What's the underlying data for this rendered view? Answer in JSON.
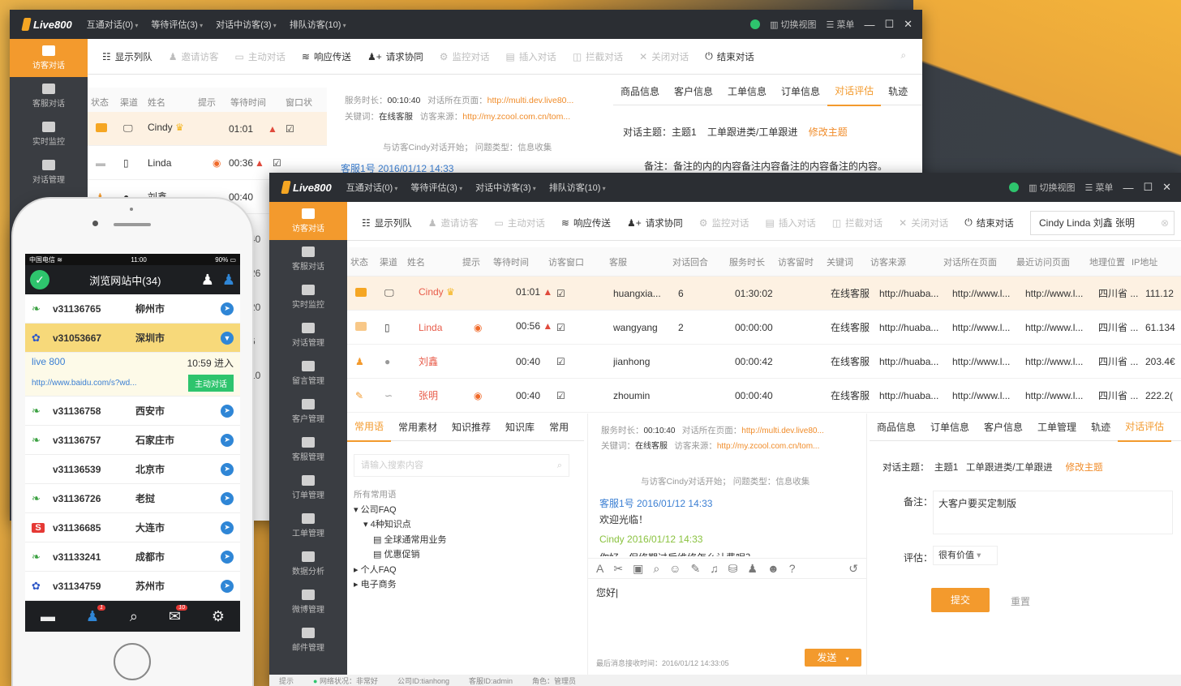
{
  "back_window": {
    "logo": "Live800",
    "menus": [
      "互通对话(0)",
      "等待评估(3)",
      "对话中访客(3)",
      "排队访客(10)"
    ],
    "right": {
      "switch": "切换视图",
      "menu": "菜单"
    },
    "sidebar": [
      {
        "label": "访客对话"
      },
      {
        "label": "客服对话"
      },
      {
        "label": "实时监控"
      },
      {
        "label": "对话管理"
      }
    ],
    "toolbar": [
      {
        "label": "显示列队",
        "enabled": true
      },
      {
        "label": "邀请访客",
        "enabled": false
      },
      {
        "label": "主动对话",
        "enabled": false
      },
      {
        "label": "响应传送",
        "enabled": true
      },
      {
        "label": "请求协同",
        "enabled": true
      },
      {
        "label": "监控对话",
        "enabled": false
      },
      {
        "label": "插入对话",
        "enabled": false
      },
      {
        "label": "拦截对话",
        "enabled": false
      },
      {
        "label": "关闭对话",
        "enabled": false
      },
      {
        "label": "结束对话",
        "enabled": true
      }
    ],
    "columns": [
      "状态",
      "渠道",
      "姓名",
      "提示",
      "等待时间",
      "窗口状"
    ],
    "rows": [
      {
        "name": "Cindy",
        "wait": "01:01"
      },
      {
        "name": "Linda",
        "wait": "00:36"
      },
      {
        "name": "刘鑫",
        "wait": "00:40"
      }
    ],
    "row_times_clipped": [
      "40",
      "26",
      "20",
      "6",
      "10"
    ],
    "info": {
      "duration_label": "服务时长：",
      "duration": "00:10:40",
      "page_label": "对话所在页面：",
      "page": "http://multi.dev.live80...",
      "keyword_label": "关键词：",
      "keyword": "在线客服",
      "source_label": "访客来源：",
      "source": "http://my.zcool.com.cn/tom..."
    },
    "system_msg": "与访客Cindy对话开始；  问题类型：信息收集",
    "msg_meta": "客服1号  2016/01/12  14:33",
    "tabs": [
      "商品信息",
      "客户信息",
      "工单信息",
      "订单信息",
      "对话评估",
      "轨迹"
    ],
    "topic_label": "对话主题：",
    "topic": "主题1",
    "ticket": "工单跟进类/工单跟进",
    "edit_topic": "修改主题",
    "note_label": "备注：",
    "note": "备注的内的内容备注内容备注的内容备注的内容。"
  },
  "front_window": {
    "logo": "Live800",
    "menus": [
      "互通对话(0)",
      "等待评估(3)",
      "对话中访客(3)",
      "排队访客(10)"
    ],
    "right": {
      "switch": "切换视图",
      "menu": "菜单"
    },
    "sidebar": [
      {
        "label": "访客对话"
      },
      {
        "label": "客服对话"
      },
      {
        "label": "实时监控"
      },
      {
        "label": "对话管理"
      },
      {
        "label": "留言管理"
      },
      {
        "label": "客户管理"
      },
      {
        "label": "客服管理"
      },
      {
        "label": "订单管理"
      },
      {
        "label": "工单管理"
      },
      {
        "label": "数据分析"
      },
      {
        "label": "微博管理"
      },
      {
        "label": "邮件管理"
      }
    ],
    "toolbar": [
      {
        "label": "显示列队",
        "enabled": true
      },
      {
        "label": "邀请访客",
        "enabled": false
      },
      {
        "label": "主动对话",
        "enabled": false
      },
      {
        "label": "响应传送",
        "enabled": true
      },
      {
        "label": "请求协同",
        "enabled": true
      },
      {
        "label": "监控对话",
        "enabled": false
      },
      {
        "label": "插入对话",
        "enabled": false
      },
      {
        "label": "拦截对话",
        "enabled": false
      },
      {
        "label": "关闭对话",
        "enabled": false
      },
      {
        "label": "结束对话",
        "enabled": true
      }
    ],
    "search_value": "Cindy Linda 刘鑫 张明",
    "columns": [
      "状态",
      "渠道",
      "姓名",
      "提示",
      "等待时间",
      "访客窗口",
      "客服",
      "对话回合",
      "服务时长",
      "访客留时",
      "关键词",
      "访客来源",
      "对话所在页面",
      "最近访问页面",
      "地理位置",
      "IP地址"
    ],
    "rows": [
      {
        "name": "Cindy",
        "wait": "01:01",
        "agent": "huangxia...",
        "rounds": "6",
        "duration": "01:30:02",
        "keyword": "在线客服",
        "source": "http://huaba...",
        "page": "http://www.l...",
        "recent": "http://www.l...",
        "geo": "四川省 ...",
        "ip": "111.12"
      },
      {
        "name": "Linda",
        "wait": "00:56",
        "agent": "wangyang",
        "rounds": "2",
        "duration": "00:00:00",
        "keyword": "在线客服",
        "source": "http://huaba...",
        "page": "http://www.l...",
        "recent": "http://www.l...",
        "geo": "四川省 ...",
        "ip": "61.134"
      },
      {
        "name": "刘鑫",
        "wait": "00:40",
        "agent": "jianhong",
        "rounds": "",
        "duration": "00:00:42",
        "keyword": "在线客服",
        "source": "http://huaba...",
        "page": "http://www.l...",
        "recent": "http://www.l...",
        "geo": "四川省 ...",
        "ip": "203.4€"
      },
      {
        "name": "张明",
        "wait": "00:40",
        "agent": "zhoumin",
        "rounds": "",
        "duration": "00:00:40",
        "keyword": "在线客服",
        "source": "http://huaba...",
        "page": "http://www.l...",
        "recent": "http://www.l...",
        "geo": "四川省 ...",
        "ip": "222.2("
      }
    ],
    "left_tabs": [
      "常用语",
      "常用素材",
      "知识推荐",
      "知识库",
      "常用"
    ],
    "search_placeholder": "请输入搜索内容",
    "tree": {
      "header": "所有常用语",
      "items": [
        "公司FAQ",
        "4种知识点",
        "全球通常用业务",
        "优惠促销",
        "个人FAQ",
        "电子商务"
      ]
    },
    "info": {
      "duration_label": "服务时长：",
      "duration": "00:10:40",
      "page_label": "对话所在页面：",
      "page": "http://multi.dev.live80...",
      "keyword_label": "关键词：",
      "keyword": "在线客服",
      "source_label": "访客来源：",
      "source": "http://my.zcool.com.cn/tom..."
    },
    "system_msg": "与访客Cindy对话开始；  问题类型：信息收集",
    "messages": [
      {
        "meta": "客服1号  2016/01/12  14:33",
        "text": "欢迎光临！"
      },
      {
        "meta": "Cindy  2016/01/12  14:33",
        "text": "你好，保修期过后维修怎么计费呢？"
      }
    ],
    "input_text": "您好|",
    "last_msg_time": "最后消息接收时间：2016/01/12 14:33:05",
    "send": "发送",
    "right_tabs": [
      "商品信息",
      "订单信息",
      "客户信息",
      "工单管理",
      "轨迹",
      "对话评估"
    ],
    "topic_label": "对话主题：",
    "topic": "主题1",
    "ticket": "工单跟进类/工单跟进",
    "edit_topic": "修改主题",
    "note_label": "备注：",
    "note": "大客户要买定制版",
    "rating_label": "评估：",
    "rating": "很有价值",
    "submit": "提交",
    "reset": "重置",
    "status_bar": {
      "hint": "提示",
      "network": "网络状况：非常好",
      "company": "公司ID:tianhong",
      "agent": "客服ID:admin",
      "role": "角色：管理员"
    }
  },
  "phone": {
    "carrier": "中国电信",
    "time": "11:00",
    "battery": "90%",
    "title": "浏览网站中(34)",
    "visitors": [
      {
        "id": "v31136765",
        "city": "柳州市",
        "src": "leaf"
      },
      {
        "id": "v31053667",
        "city": "深圳市",
        "src": "baidu",
        "selected": true
      },
      {
        "id": "v31136758",
        "city": "西安市",
        "src": "leaf"
      },
      {
        "id": "v31136757",
        "city": "石家庄市",
        "src": "leaf"
      },
      {
        "id": "v31136539",
        "city": "北京市",
        "src": "none"
      },
      {
        "id": "v31136726",
        "city": "老挝",
        "src": "leaf"
      },
      {
        "id": "v31136685",
        "city": "大连市",
        "src": "sogou"
      },
      {
        "id": "v31133241",
        "city": "成都市",
        "src": "leaf"
      },
      {
        "id": "v31134759",
        "city": "苏州市",
        "src": "baidu"
      }
    ],
    "detail": {
      "source": "live 800",
      "time": "10:59 进入",
      "url": "http://www.baidu.com/s?wd...",
      "action": "主动对话"
    },
    "bottom": [
      {
        "label": "对话",
        "badge": ""
      },
      {
        "label": "访客",
        "badge": "1"
      },
      {
        "label": "对话记录",
        "badge": ""
      },
      {
        "label": "留言",
        "badge": "10"
      },
      {
        "label": "设置",
        "badge": ""
      }
    ],
    "colors": {
      "accent": "#f39a2d",
      "green": "#2ec46d",
      "blue": "#2f86d6"
    }
  }
}
